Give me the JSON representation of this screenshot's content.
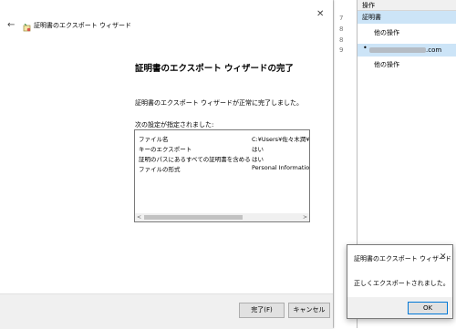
{
  "background": {
    "numbers": [
      "7",
      "8",
      "8",
      "9"
    ],
    "actions_header": "操作",
    "selected_item": "証明書",
    "other_ops_1": "他の操作",
    "email_domain": ".com",
    "other_ops_2": "他の操作"
  },
  "wizard": {
    "header_title": "証明書のエクスポート ウィザード",
    "title": "証明書のエクスポート ウィザードの完了",
    "subtitle": "証明書のエクスポート ウィザードが正常に完了しました。",
    "settings_label": "次の設定が指定されました:",
    "settings": [
      {
        "name": "ファイル名",
        "value": "C:¥Users¥佐々木潤¥"
      },
      {
        "name": "キーのエクスポート",
        "value": "はい"
      },
      {
        "name": "証明のパスにあるすべての証明書を含める",
        "value": "はい"
      },
      {
        "name": "ファイルの形式",
        "value": "Personal Informatio"
      }
    ],
    "finish_button": "完了(F)",
    "cancel_button": "キャンセル"
  },
  "dialog": {
    "title": "証明書のエクスポート ウィザード",
    "message": "正しくエクスポートされました。",
    "ok_button": "OK"
  }
}
